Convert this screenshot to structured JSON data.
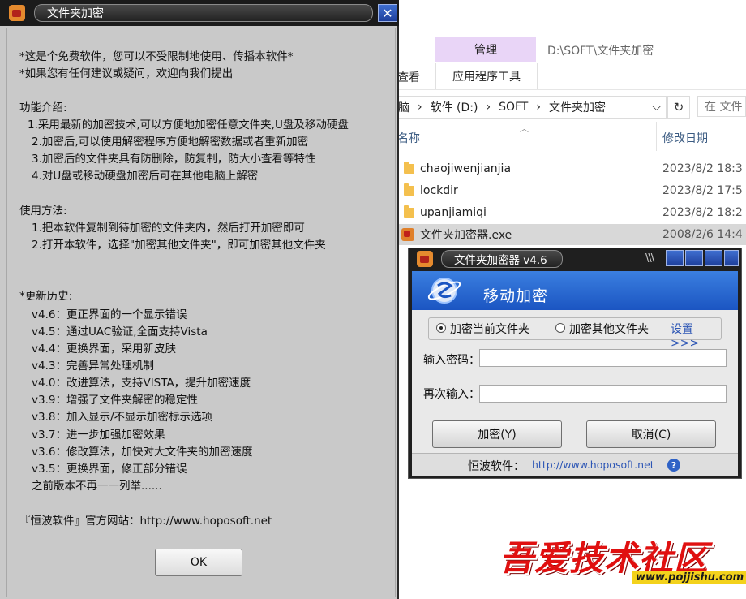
{
  "explorer": {
    "ribbon_manage": "管理",
    "ribbon_view_partial": "查看",
    "ribbon_app_tools": "应用程序工具",
    "path_title": "D:\\SOFT\\文件夹加密",
    "address_crumbs": [
      "脑",
      "软件 (D:)",
      "SOFT",
      "文件夹加密"
    ],
    "search_placeholder": "在 文件",
    "col_name": "名称",
    "col_modified": "修改日期",
    "files": [
      {
        "name": "chaojiwenjianjia",
        "date": "2023/8/2 18:3",
        "type": "folder"
      },
      {
        "name": "lockdir",
        "date": "2023/8/2 17:5",
        "type": "folder"
      },
      {
        "name": "upanjiamiqi",
        "date": "2023/8/2 18:2",
        "type": "folder"
      },
      {
        "name": "文件夹加密器.exe",
        "date": "2008/2/6 14:4",
        "type": "exe"
      }
    ]
  },
  "info_dialog": {
    "title": "文件夹加密",
    "lines": [
      "*这是个免费软件，您可以不受限制地使用、传播本软件*",
      "*如果您有任何建议或疑问，欢迎向我们提出",
      "功能介绍:",
      "1.采用最新的加密技术,可以方便地加密任意文件夹,U盘及移动硬盘",
      "2.加密后,可以使用解密程序方便地解密数据或者重新加密",
      "3.加密后的文件夹具有防删除，防复制，防大小查看等特性",
      "4.对U盘或移动硬盘加密后可在其他电脑上解密",
      "使用方法:",
      "1.把本软件复制到待加密的文件夹内，然后打开加密即可",
      "2.打开本软件，选择\"加密其他文件夹\"，即可加密其他文件夹",
      "*更新历史:",
      "v4.6：更正界面的一个显示错误",
      "v4.5：通过UAC验证,全面支持Vista",
      "v4.4：更换界面，采用新皮肤",
      "v4.3：完善异常处理机制",
      "v4.0：改进算法，支持VISTA，提升加密速度",
      "v3.9：增强了文件夹解密的稳定性",
      "v3.8：加入显示/不显示加密标示选项",
      "v3.7：进一步加强加密效果",
      "v3.6：修改算法，加快对大文件夹的加密速度",
      "v3.5：更换界面，修正部分错误",
      "之前版本不再一一列举......",
      "『恒波软件』官方网站：http://www.hoposoft.net"
    ],
    "ok_label": "OK",
    "close_glyph": "✕"
  },
  "encryptor": {
    "title": "文件夹加密器 v4.6",
    "grip": "\\\\\\",
    "banner_title": "移动加密",
    "radio_current": "加密当前文件夹",
    "radio_other": "加密其他文件夹",
    "settings_link": "设置>>>",
    "password_label": "输入密码：",
    "confirm_label": "再次输入：",
    "encrypt_button": "加密(Y)",
    "cancel_button": "取消(C)",
    "footer_company": "恒波软件：",
    "footer_url": "http://www.hoposoft.net",
    "help_glyph": "?",
    "selected_radio": "current"
  },
  "watermark": {
    "title": "吾爱技术社区",
    "url": "www.pojjishu.com"
  },
  "colors": {
    "banner_blue": "#1b55c2",
    "link_blue": "#2d56b5",
    "watermark_red": "#e01010",
    "ribbon_purple": "#e9d5f7"
  }
}
